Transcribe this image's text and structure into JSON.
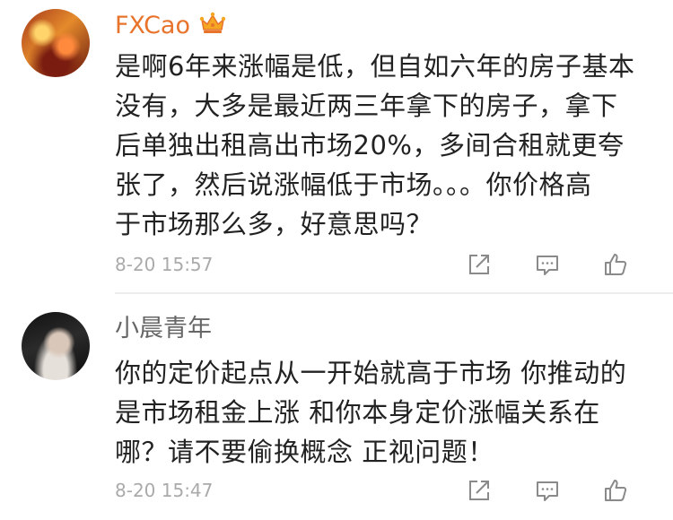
{
  "comments": [
    {
      "username": "FXCao",
      "badge_icon": "crown-badge-icon",
      "text_lines": [
        "是啊6年来涨幅是低，但自如六年的房子基本",
        "没有，大多是最近两三年拿下的房子，拿下",
        "后单独出租高出市场20%，多间合租就更夸",
        "张了，然后说涨幅低于市场。。。你价格高",
        "于市场那么多，好意思吗？"
      ],
      "timestamp": "8-20 15:57"
    },
    {
      "username": "小晨青年",
      "text_lines": [
        "你的定价起点从一开始就高于市场 你推动的",
        "是市场租金上涨 和你本身定价涨幅关系在",
        "哪？请不要偷换概念 正视问题！"
      ],
      "timestamp": "8-20 15:47"
    }
  ],
  "action_icons": [
    "share-icon",
    "reply-icon",
    "like-icon"
  ],
  "colors": {
    "vip_name": "#e8742c",
    "name": "#666666",
    "text": "#222222",
    "timestamp": "#aaaaaa",
    "icon": "#8a8a8a"
  }
}
